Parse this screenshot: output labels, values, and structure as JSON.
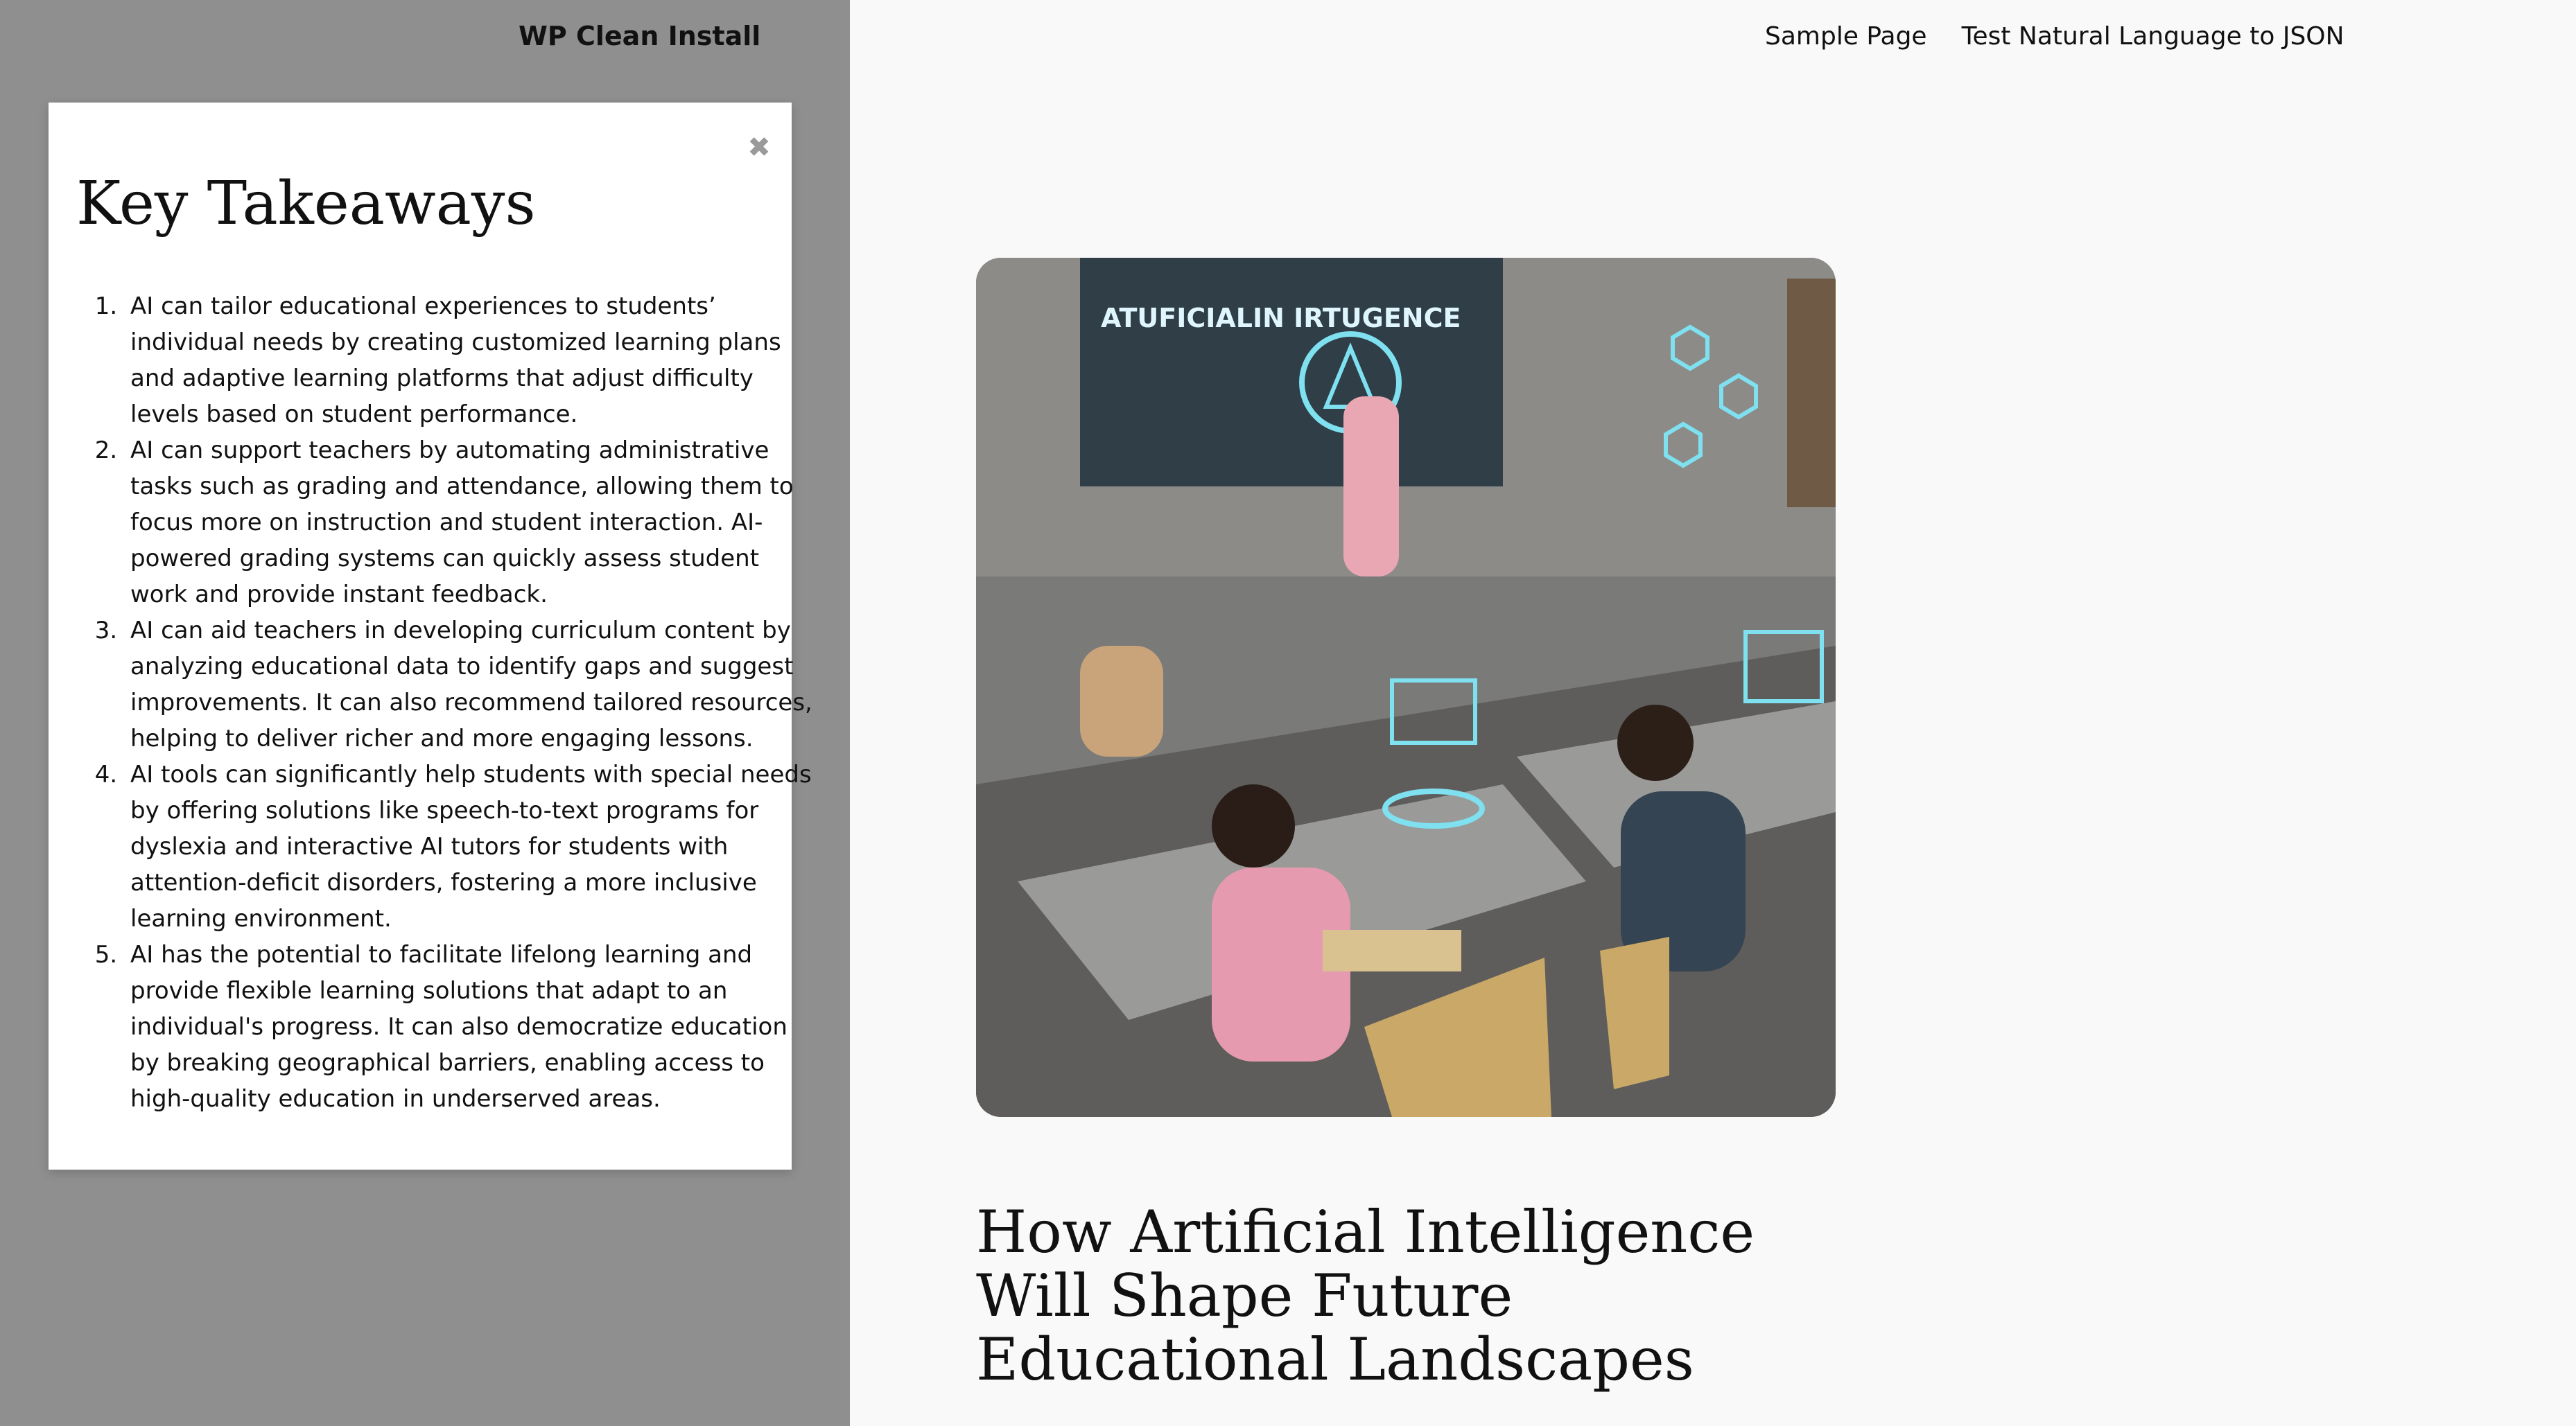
{
  "header": {
    "site_title": "WP Clean Install",
    "nav": [
      {
        "label": "Sample Page"
      },
      {
        "label": "Test Natural Language to JSON"
      }
    ]
  },
  "modal": {
    "close_icon": "close-icon",
    "title": "Key Takeaways",
    "items": [
      {
        "text": "AI can tailor educational experiences to students’ individual needs by creating customized learning plans and adaptive learning platforms that adjust difficulty levels based on student performance."
      },
      {
        "text": "AI can support teachers by automating administrative tasks such as grading and attendance, allowing them to focus more on instruction and student interaction. AI-powered grading systems can quickly assess student work and provide instant feedback."
      },
      {
        "text": "AI can aid teachers in developing curriculum content by analyzing educational data to identify gaps and suggest improvements. It can also recommend tailored resources, helping to deliver richer and more engaging lessons."
      },
      {
        "text": "AI tools can significantly help students with special needs by offering solutions like speech-to-text programs for dyslexia and interactive AI tutors for students with attention-deficit disorders, fostering a more inclusive learning environment."
      },
      {
        "text": "AI has the potential to facilitate lifelong learning and provide flexible learning solutions that adapt to an individual's progress. It can also democratize education by breaking geographical barriers, enabling access to high-quality education in underserved areas."
      }
    ]
  },
  "article": {
    "image_screen_text": "ATUFICIALIN IRTUGENCE",
    "title": "How Artificial Intelligence Will Shape Future Educational Landscapes"
  },
  "colors": {
    "overlay": "#8f8f8f",
    "page_bg": "#f9f9f9",
    "modal_bg": "#ffffff",
    "text": "#111111"
  }
}
